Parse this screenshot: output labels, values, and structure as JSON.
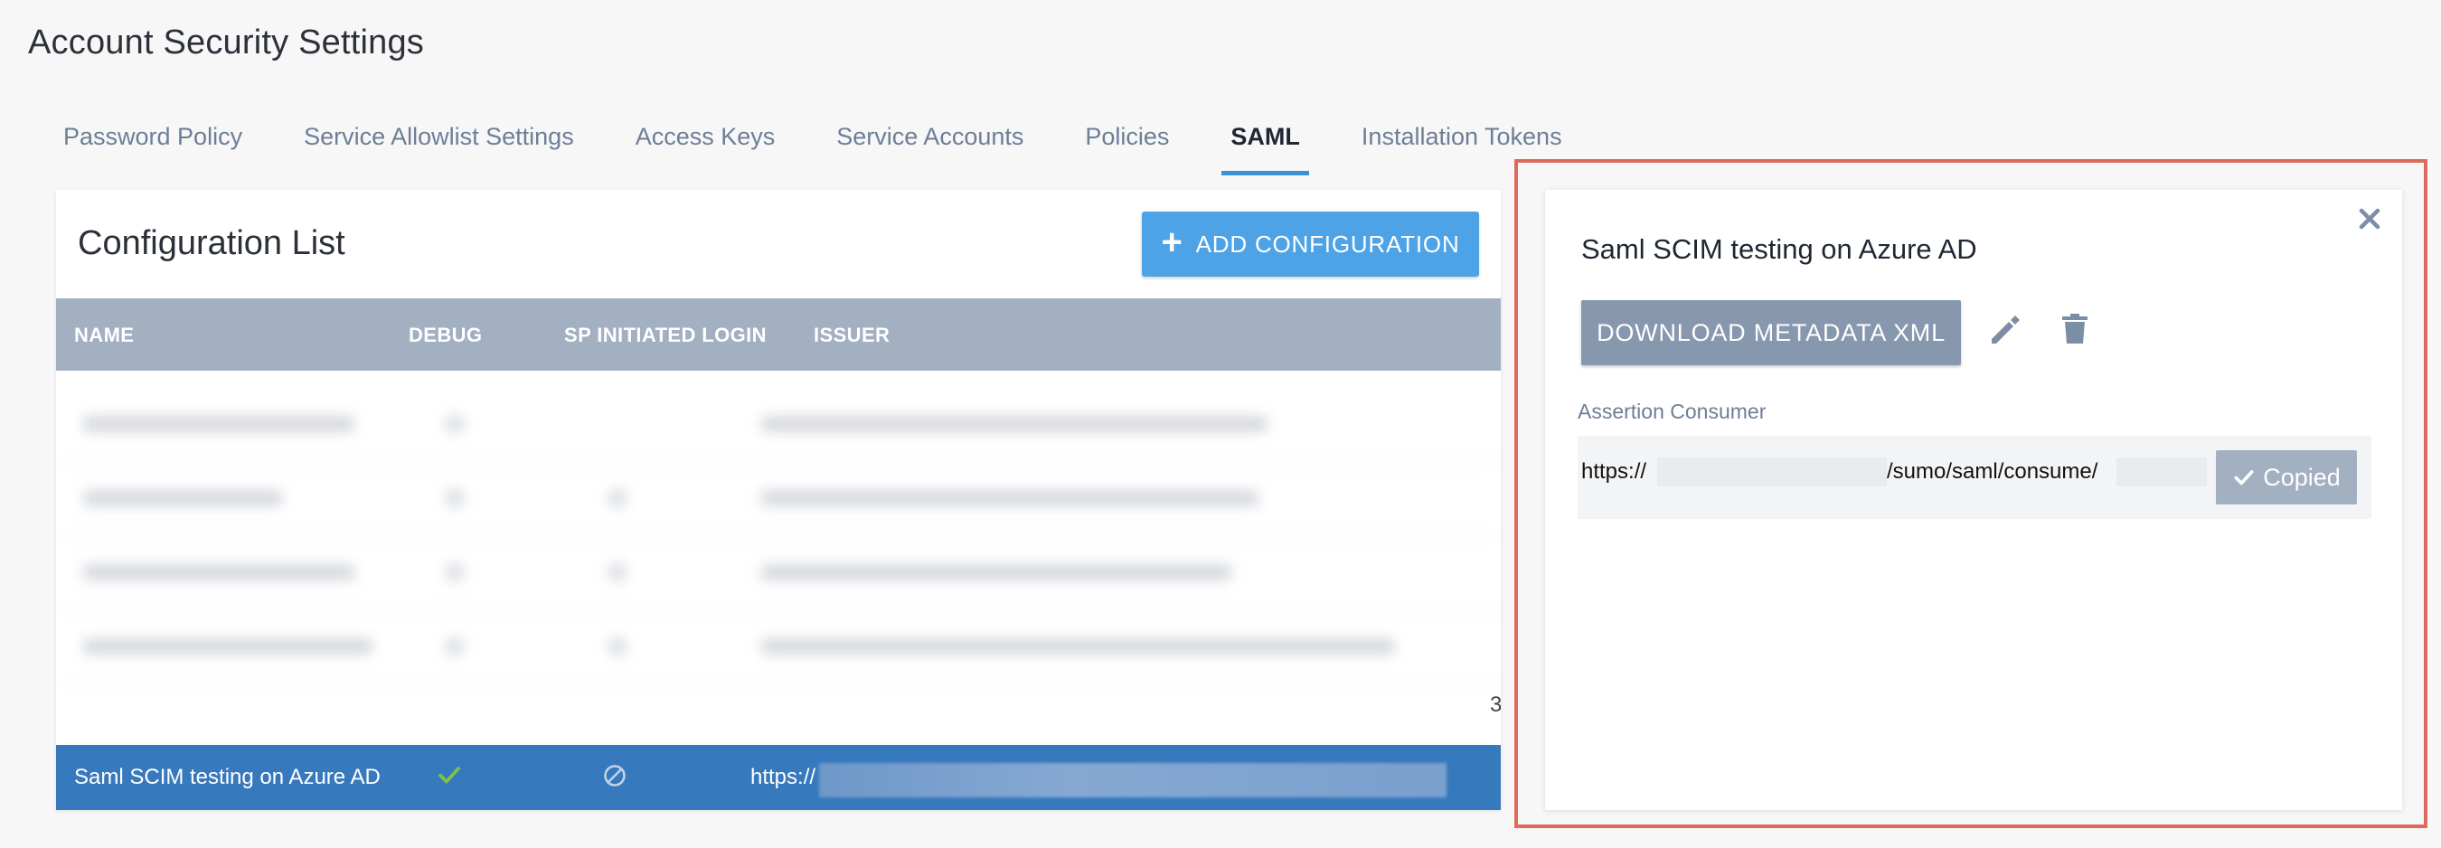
{
  "page": {
    "title": "Account Security Settings"
  },
  "tabs": [
    {
      "label": "Password Policy"
    },
    {
      "label": "Service Allowlist Settings"
    },
    {
      "label": "Access Keys"
    },
    {
      "label": "Service Accounts"
    },
    {
      "label": "Policies"
    },
    {
      "label": "SAML",
      "active": true
    },
    {
      "label": "Installation Tokens"
    }
  ],
  "config_list": {
    "title": "Configuration List",
    "add_button_label": "ADD CONFIGURATION",
    "columns": [
      "NAME",
      "DEBUG",
      "SP INITIATED LOGIN",
      "ISSUER"
    ],
    "scroll_fragment": "3",
    "selected_row": {
      "name": "Saml SCIM testing on Azure AD",
      "debug_icon": "check-icon",
      "sp_login_icon": "no-entry-icon",
      "issuer_prefix": "https://"
    }
  },
  "detail": {
    "title": "Saml SCIM testing on Azure AD",
    "download_label": "DOWNLOAD METADATA XML",
    "assertion_label": "Assertion Consumer",
    "assertion_prefix": "https://",
    "assertion_path": "/sumo/saml/consume/",
    "copied_label": "Copied"
  },
  "colors": {
    "accent": "#4ea3e6",
    "selected_row": "#3779bd",
    "table_header": "#a2b0c2",
    "highlight": "#dd6a5c",
    "check": "#7ec24a"
  }
}
